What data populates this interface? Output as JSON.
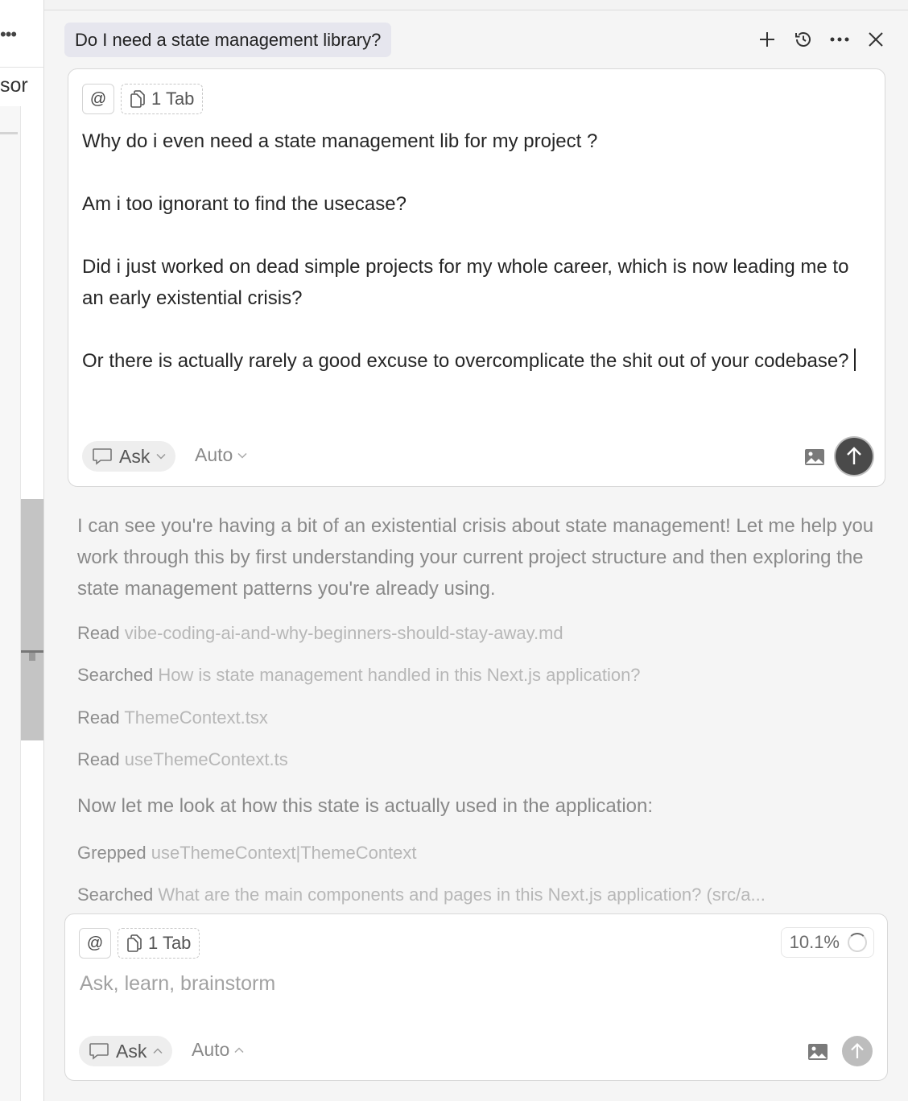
{
  "left_panel": {
    "menu_dots": "•••",
    "tab_fragment": "sor"
  },
  "header": {
    "chat_title": "Do I need a state management library?",
    "actions": [
      "plus-icon",
      "history-icon",
      "more-icon",
      "close-icon"
    ]
  },
  "top_composer": {
    "mention_symbol": "@",
    "tab_context_label": "1 Tab",
    "message_lines": [
      "Why do i even need a state management lib for my project ?",
      "",
      "Am i too ignorant to find the usecase?",
      "",
      "Did i just worked on dead simple projects for my whole career, which is now leading me to an early existential crisis?",
      "",
      "Or there is actually rarely a good excuse to overcomplicate the shit out of your codebase?"
    ],
    "mode_label": "Ask",
    "model_label": "Auto"
  },
  "conversation": {
    "assistant_intro": "I can see you're having a bit of an existential crisis about state management! Let me help you work through this by first understanding your current project structure and then exploring the state management patterns you're already using.",
    "tool_calls_1": [
      {
        "verb": "Read",
        "target": "vibe-coding-ai-and-why-beginners-should-stay-away.md"
      },
      {
        "verb": "Searched",
        "target": "How is state management handled in this Next.js application?"
      },
      {
        "verb": "Read",
        "target": "ThemeContext.tsx"
      },
      {
        "verb": "Read",
        "target": "useThemeContext.ts"
      }
    ],
    "assistant_followup": "Now let me look at how this state is actually used in the application:",
    "tool_calls_2": [
      {
        "verb": "Grepped",
        "target": "useThemeContext|ThemeContext"
      },
      {
        "verb": "Searched",
        "target": "What are the main components and pages in this Next.js application? (src/a..."
      }
    ]
  },
  "bottom_composer": {
    "mention_symbol": "@",
    "tab_context_label": "1 Tab",
    "usage_percent": "10.1%",
    "placeholder": "Ask, learn, brainstorm",
    "mode_label": "Ask",
    "model_label": "Auto"
  }
}
